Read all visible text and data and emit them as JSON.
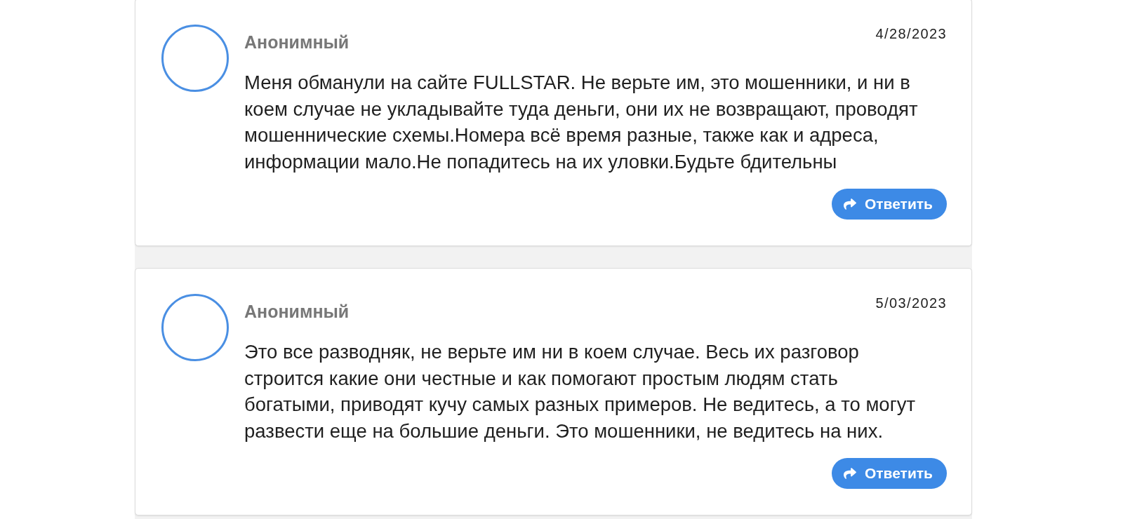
{
  "reviews": [
    {
      "author": "Анонимный",
      "date": "4/28/2023",
      "text": "Меня обманули на сайте FULLSTAR. Не верьте им, это мошенники, и ни в коем случае не укладывайте туда деньги, они их не возвращают, проводят мошеннические схемы.Номера всё время разные, также как и адреса, информации мало.Не попадитесь на их уловки.Будьте бдительны",
      "reply_button": "Ответить"
    },
    {
      "author": "Анонимный",
      "date": "5/03/2023",
      "text": "Это все разводняк, не верьте им ни в коем случае. Весь их разговор строится какие они честные и как помогают простым людям стать богатыми, приводят кучу самых разных примеров. Не ведитесь, а то могут развести еще на большие деньги. Это мошенники, не ведитесь на них.",
      "reply_button": "Ответить"
    }
  ]
}
